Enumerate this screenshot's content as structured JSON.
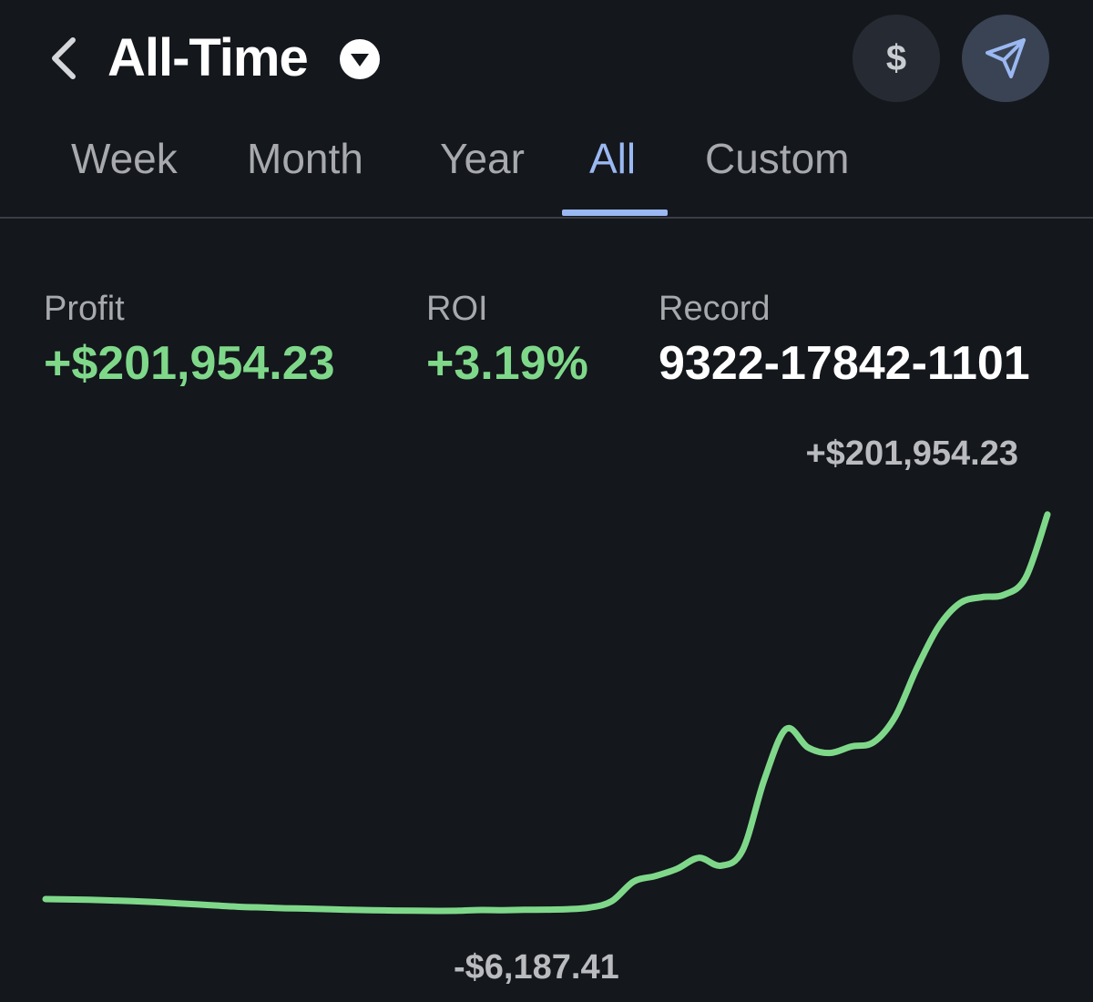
{
  "header": {
    "title": "All-Time",
    "currency_button": "$"
  },
  "tabs": [
    {
      "label": "Week",
      "active": false
    },
    {
      "label": "Month",
      "active": false
    },
    {
      "label": "Year",
      "active": false
    },
    {
      "label": "All",
      "active": true
    },
    {
      "label": "Custom",
      "active": false
    }
  ],
  "stats": {
    "profit": {
      "label": "Profit",
      "value": "+$201,954.23"
    },
    "roi": {
      "label": "ROI",
      "value": "+3.19%"
    },
    "record": {
      "label": "Record",
      "value": "9322-17842-1101"
    }
  },
  "colors": {
    "background": "#14171c",
    "accent": "#9ab8f2",
    "positive": "#7fd88a",
    "muted_text": "#a7a9ad"
  },
  "icons": {
    "back": "chevron-left-icon",
    "dropdown": "caret-down-circle-icon",
    "share": "send-arrow-icon"
  },
  "chart_data": {
    "type": "line",
    "title": "",
    "xlabel": "",
    "ylabel": "",
    "max_label": "+$201,954.23",
    "min_label": "-$6,187.41",
    "ylim": [
      -6187.41,
      201954.23
    ],
    "grid": false,
    "series": [
      {
        "values": [
          0,
          -200,
          -400,
          -700,
          -1100,
          -1600,
          -2200,
          -2800,
          -3500,
          -4100,
          -4400,
          -4800,
          -5000,
          -5300,
          -5600,
          -5800,
          -6000,
          -6100,
          -6187.41,
          -6100,
          -5700,
          -5800,
          -5600,
          -5500,
          -5300,
          -4400,
          -1100,
          9100,
          12000,
          15800,
          21500,
          17400,
          25300,
          62300,
          88700,
          79100,
          76200,
          79600,
          81700,
          94900,
          120300,
          142100,
          154500,
          157500,
          158700,
          167700,
          200600
        ]
      }
    ]
  }
}
